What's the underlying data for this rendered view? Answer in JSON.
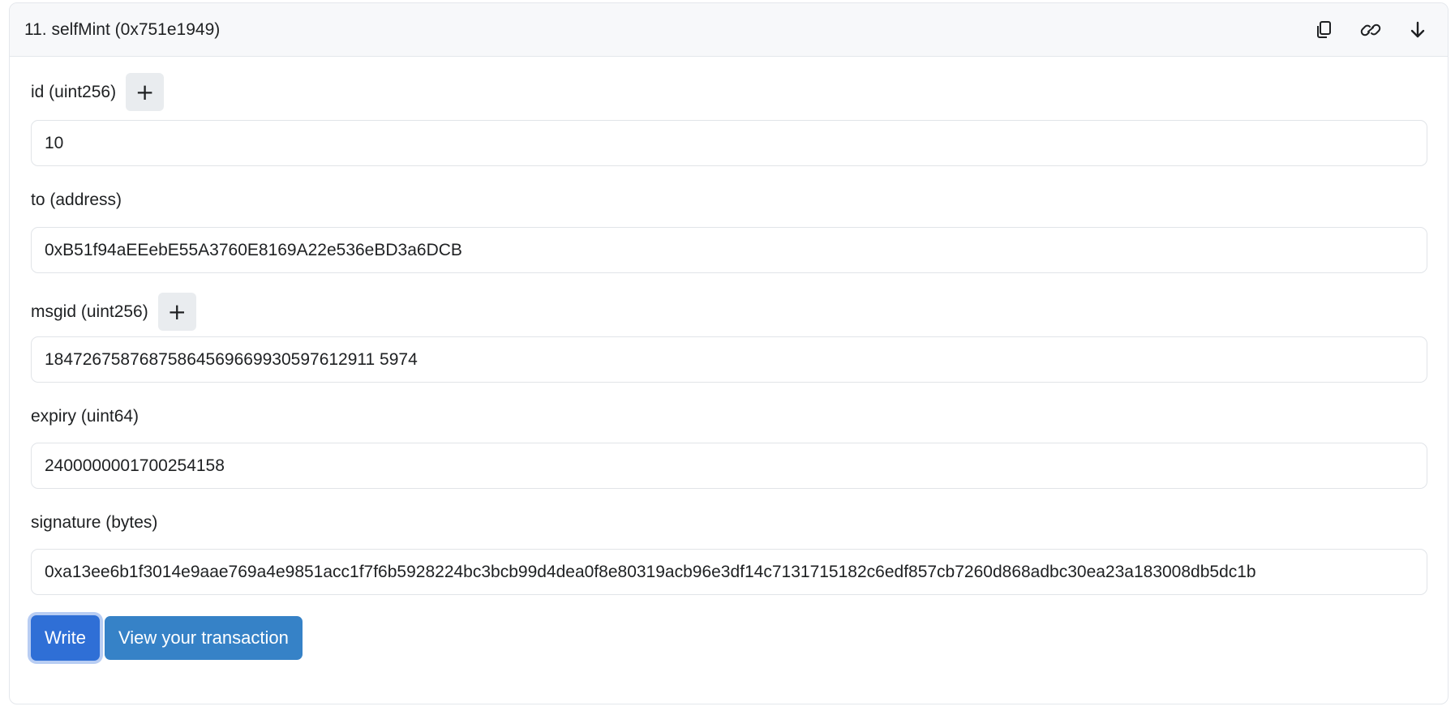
{
  "header": {
    "title": "11. selfMint (0x751e1949)",
    "icons": [
      "copy-icon",
      "link-icon",
      "arrow-down-icon"
    ]
  },
  "fields": [
    {
      "label": "id (uint256)",
      "value": "10",
      "has_plus": true
    },
    {
      "label": "to (address)",
      "value": "0xB51f94aEEebE55A3760E8169A22e536eBD3a6DCB",
      "has_plus": false
    },
    {
      "label": "msgid (uint256)",
      "value": "18472675876875864569669930597612911 5974",
      "has_plus": true
    },
    {
      "label": "expiry (uint64)",
      "value": "2400000001700254158",
      "has_plus": false
    },
    {
      "label": "signature (bytes)",
      "value": "0xa13ee6b1f3014e9aae769a4e9851acc1f7f6b5928224bc3bcb99d4dea0f8e80319acb96e3df14c7131715182c6edf857cb7260d868adbc30ea23a183008db5dc1b",
      "has_plus": false
    }
  ],
  "plus_symbol": "+",
  "actions": {
    "write_label": "Write",
    "view_label": "View your transaction"
  }
}
